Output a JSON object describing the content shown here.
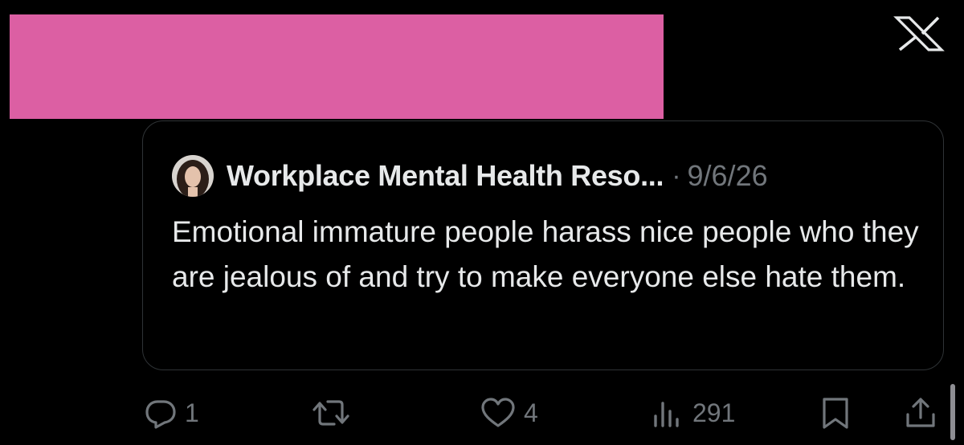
{
  "post": {
    "redacted": true,
    "redaction_color": "#dc5fa3"
  },
  "brand": {
    "logo_icon": "x-logo-icon"
  },
  "quoted_post": {
    "author_name": "Workplace Mental Health Reso...",
    "separator": "·",
    "date": "9/6/26",
    "text": "Emotional immature people harass nice people who they are jealous of and try to make everyone else hate them."
  },
  "actions": {
    "reply": {
      "icon": "reply-icon",
      "count": "1"
    },
    "repost": {
      "icon": "repost-icon",
      "count": ""
    },
    "like": {
      "icon": "heart-icon",
      "count": "4"
    },
    "views": {
      "icon": "views-icon",
      "count": "291"
    },
    "bookmark": {
      "icon": "bookmark-icon"
    },
    "share": {
      "icon": "share-icon"
    }
  },
  "colors": {
    "background": "#000000",
    "text_primary": "#e7e9ea",
    "text_secondary": "#71767b",
    "border": "#2f3336"
  }
}
